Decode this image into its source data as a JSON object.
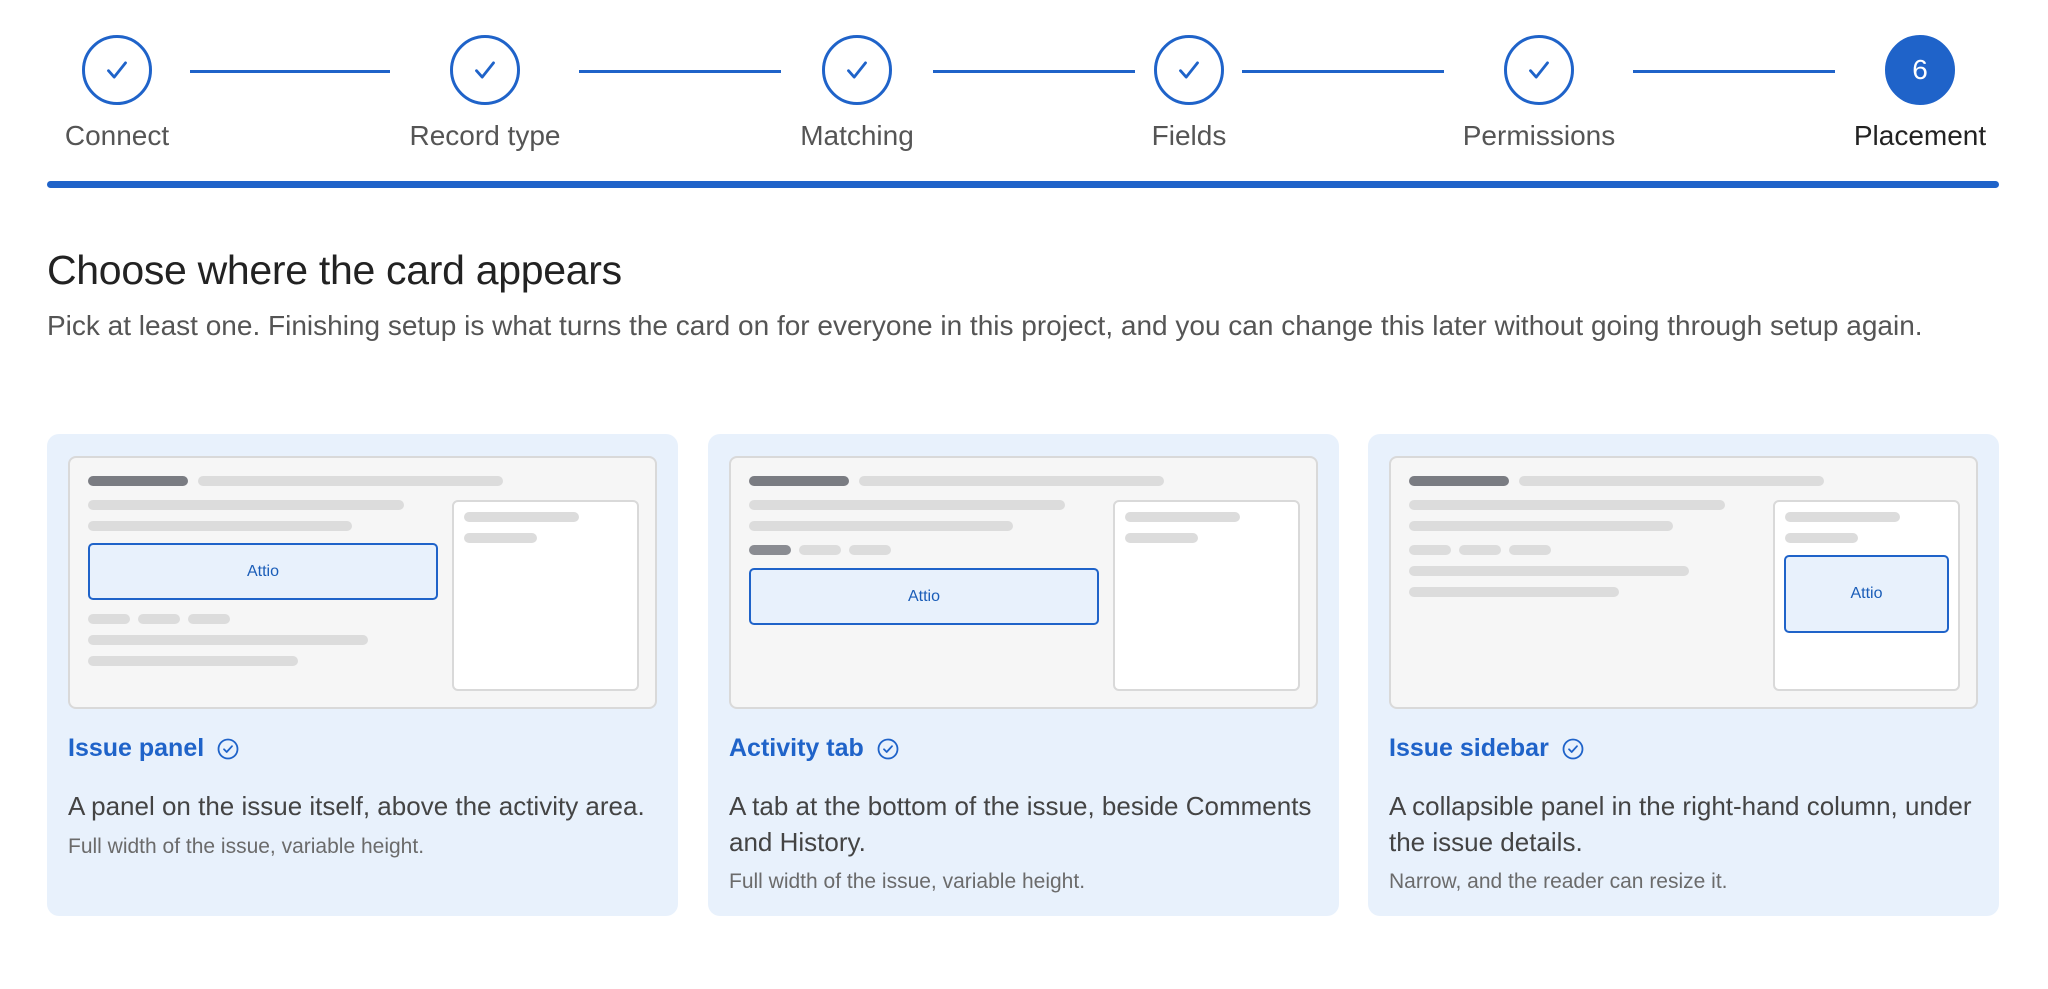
{
  "stepper": {
    "steps": [
      {
        "label": "Connect",
        "state": "complete",
        "icon": "check-icon"
      },
      {
        "label": "Record type",
        "state": "complete",
        "icon": "check-icon"
      },
      {
        "label": "Matching",
        "state": "complete",
        "icon": "check-icon"
      },
      {
        "label": "Fields",
        "state": "complete",
        "icon": "check-icon"
      },
      {
        "label": "Permissions",
        "state": "complete",
        "icon": "check-icon"
      },
      {
        "label": "Placement",
        "state": "current",
        "number": "6"
      }
    ],
    "progress_fraction": 1.0
  },
  "main": {
    "heading": "Choose where the card appears",
    "subtext": "Pick at least one. Finishing setup is what turns the card on for everyone in this project, and you can change this later without going through setup again."
  },
  "options": [
    {
      "title": "Issue panel",
      "selected": true,
      "status_icon": "check-circle-icon",
      "description": "A panel on the issue itself, above the activity area.",
      "note": "Full width of the issue, variable height.",
      "preview_label": "Attio"
    },
    {
      "title": "Activity tab",
      "selected": true,
      "status_icon": "check-circle-icon",
      "description": "A tab at the bottom of the issue, beside Comments and History.",
      "note": "Full width of the issue, variable height.",
      "preview_label": "Attio"
    },
    {
      "title": "Issue sidebar",
      "selected": true,
      "status_icon": "check-circle-icon",
      "description": "A collapsible panel in the right-hand column, under the issue details.",
      "note": "Narrow, and the reader can resize it.",
      "preview_label": "Attio"
    }
  ],
  "colors": {
    "accent": "#1f63c9",
    "card_background": "#e8f1fc",
    "text_primary": "#222222",
    "text_secondary": "#555555"
  }
}
